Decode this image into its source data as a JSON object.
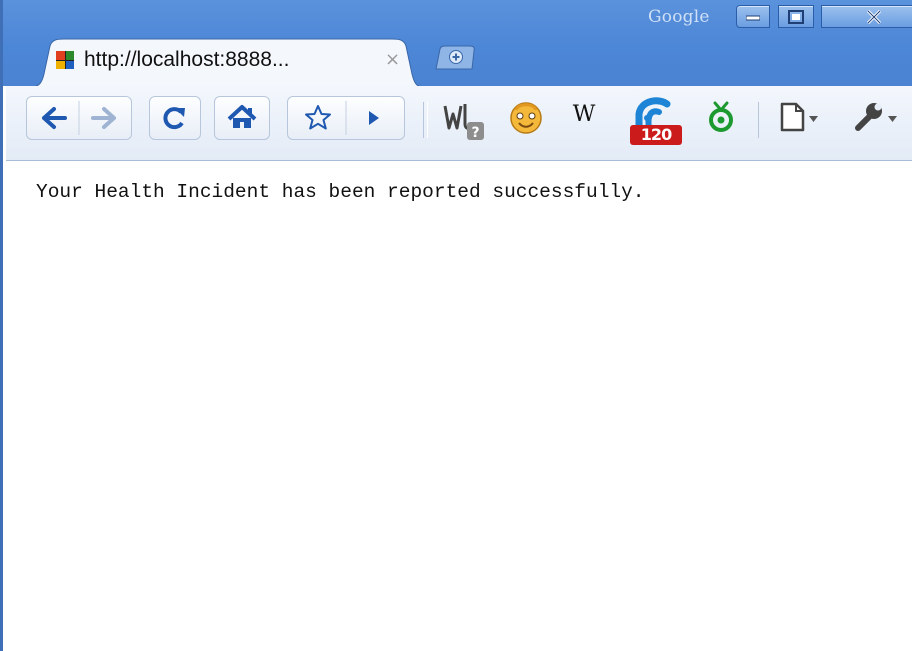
{
  "window": {
    "brand": "Google",
    "controls": {
      "minimize": "minimize",
      "maximize": "maximize",
      "close": "close"
    }
  },
  "tab": {
    "title": "http://localhost:8888...",
    "close_glyph": "×",
    "favicon": "colored-grid-favicon"
  },
  "toolbar": {
    "icons": [
      "back-arrow-icon",
      "forward-arrow-icon",
      "reload-icon",
      "home-icon",
      "star-icon",
      "play-icon"
    ],
    "extensions": [
      "web-developer-icon",
      "smiley-extension-icon",
      "wikipedia-icon",
      "feed-extension-icon",
      "green-extension-icon"
    ],
    "wikipedia_label": "W",
    "badge_count": "120",
    "page_menu_icon": "page-menu-icon",
    "wrench_menu_icon": "wrench-menu-icon"
  },
  "page": {
    "message": "Your Health Incident has been reported successfully."
  },
  "colors": {
    "titlebar": "#4c86d6",
    "accent": "#3f6fb6",
    "badge": "#cc1b1b",
    "extension_green": "#1d9a2f"
  }
}
